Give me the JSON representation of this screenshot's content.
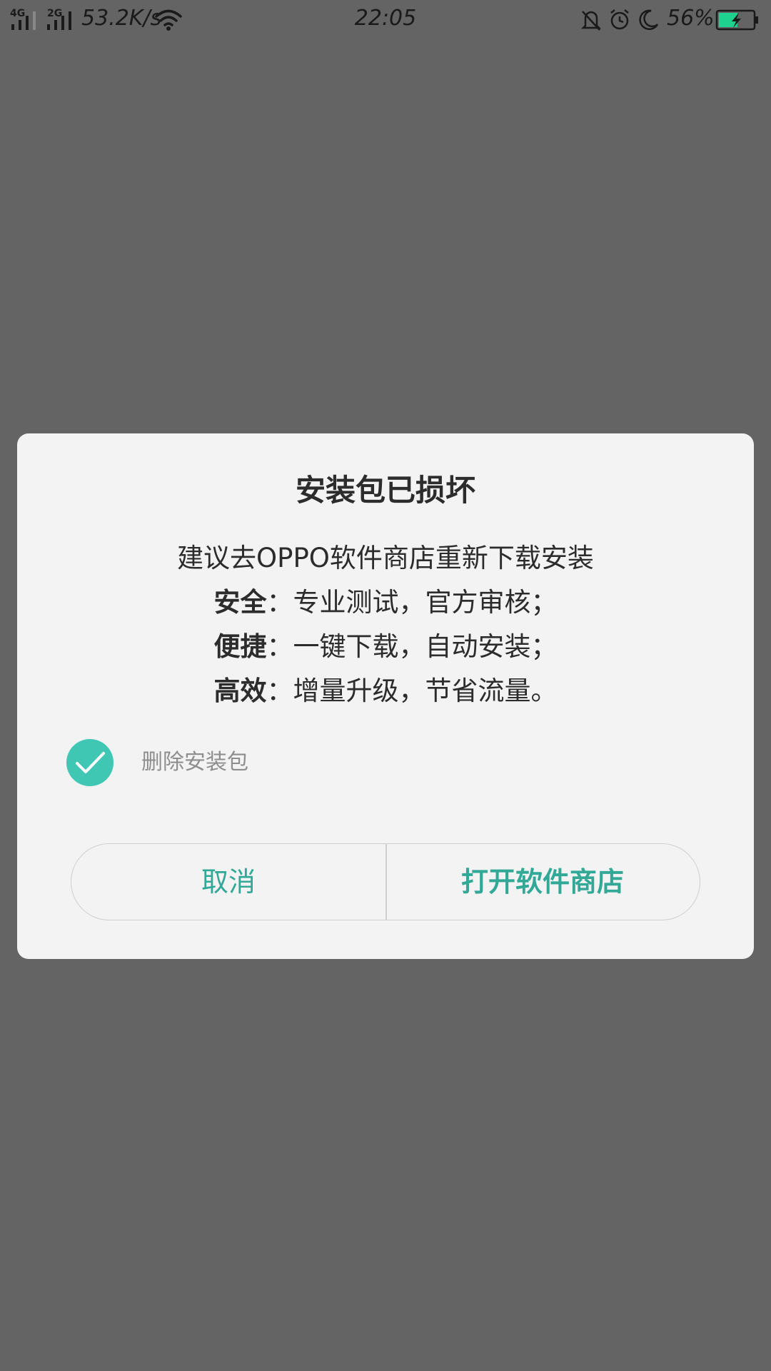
{
  "status_bar": {
    "net1_label": "4G",
    "net2_label": "2G",
    "speed": "53.2K/s",
    "time": "22:05",
    "battery_percent": "56%",
    "battery_level": 0.56,
    "icons": [
      "signal-icon",
      "wifi-icon",
      "bell-off-icon",
      "alarm-icon",
      "moon-icon",
      "battery-charging-icon"
    ],
    "battery_color": "#1fd18f"
  },
  "dialog": {
    "title": "安装包已损坏",
    "message": "建议去OPPO软件商店重新下载安装",
    "features": [
      {
        "label": "安全",
        "text": "：专业测试，官方审核；"
      },
      {
        "label": "便捷",
        "text": "：一键下载，自动安装；"
      },
      {
        "label": "高效",
        "text": "：增量升级，节省流量。"
      }
    ],
    "checkbox": {
      "label": "删除安装包",
      "checked": true,
      "color": "#3fc7b4"
    },
    "buttons": {
      "cancel": "取消",
      "open_store": "打开软件商店",
      "accent": "#32a897"
    }
  }
}
